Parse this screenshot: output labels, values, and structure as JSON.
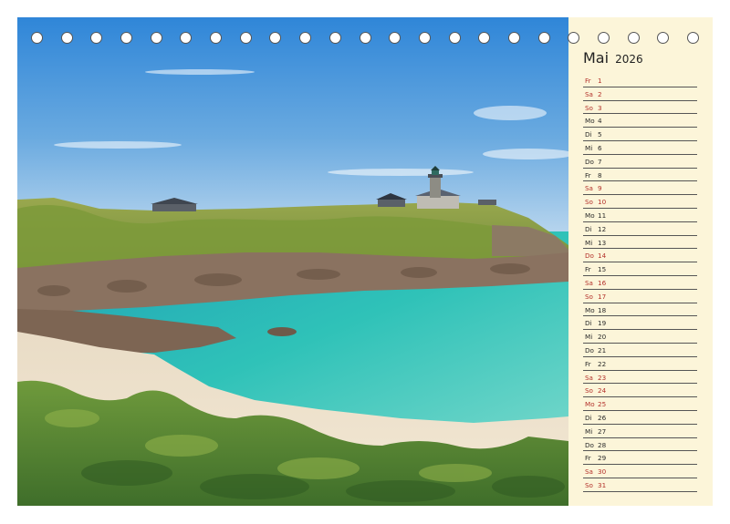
{
  "calendar": {
    "month": "Mai",
    "year": "2026",
    "days": [
      {
        "wd": "Fr",
        "d": "1",
        "type": "holiday"
      },
      {
        "wd": "Sa",
        "d": "2",
        "type": "weekend"
      },
      {
        "wd": "So",
        "d": "3",
        "type": "weekend"
      },
      {
        "wd": "Mo",
        "d": "4",
        "type": "normal"
      },
      {
        "wd": "Di",
        "d": "5",
        "type": "normal"
      },
      {
        "wd": "Mi",
        "d": "6",
        "type": "normal"
      },
      {
        "wd": "Do",
        "d": "7",
        "type": "normal"
      },
      {
        "wd": "Fr",
        "d": "8",
        "type": "normal"
      },
      {
        "wd": "Sa",
        "d": "9",
        "type": "weekend"
      },
      {
        "wd": "So",
        "d": "10",
        "type": "weekend"
      },
      {
        "wd": "Mo",
        "d": "11",
        "type": "normal"
      },
      {
        "wd": "Di",
        "d": "12",
        "type": "normal"
      },
      {
        "wd": "Mi",
        "d": "13",
        "type": "normal"
      },
      {
        "wd": "Do",
        "d": "14",
        "type": "holiday"
      },
      {
        "wd": "Fr",
        "d": "15",
        "type": "normal"
      },
      {
        "wd": "Sa",
        "d": "16",
        "type": "weekend"
      },
      {
        "wd": "So",
        "d": "17",
        "type": "weekend"
      },
      {
        "wd": "Mo",
        "d": "18",
        "type": "normal"
      },
      {
        "wd": "Di",
        "d": "19",
        "type": "normal"
      },
      {
        "wd": "Mi",
        "d": "20",
        "type": "normal"
      },
      {
        "wd": "Do",
        "d": "21",
        "type": "normal"
      },
      {
        "wd": "Fr",
        "d": "22",
        "type": "normal"
      },
      {
        "wd": "Sa",
        "d": "23",
        "type": "weekend"
      },
      {
        "wd": "So",
        "d": "24",
        "type": "weekend"
      },
      {
        "wd": "Mo",
        "d": "25",
        "type": "holiday"
      },
      {
        "wd": "Di",
        "d": "26",
        "type": "normal"
      },
      {
        "wd": "Mi",
        "d": "27",
        "type": "normal"
      },
      {
        "wd": "Do",
        "d": "28",
        "type": "normal"
      },
      {
        "wd": "Fr",
        "d": "29",
        "type": "normal"
      },
      {
        "wd": "Sa",
        "d": "30",
        "type": "weekend"
      },
      {
        "wd": "So",
        "d": "31",
        "type": "weekend"
      }
    ]
  },
  "photo": {
    "subject": "coastal-landscape-with-lighthouse",
    "colors": {
      "sky": "#4a93d6",
      "sea": "#2fb3b0",
      "sand": "#ecdcc4",
      "vegetation": "#5f8d3a",
      "rock": "#8a7260"
    }
  },
  "binding": {
    "hole_count": 23
  },
  "colors": {
    "panel_bg": "#fcf5d9",
    "weekend_red": "#b3312b",
    "text": "#222222"
  }
}
